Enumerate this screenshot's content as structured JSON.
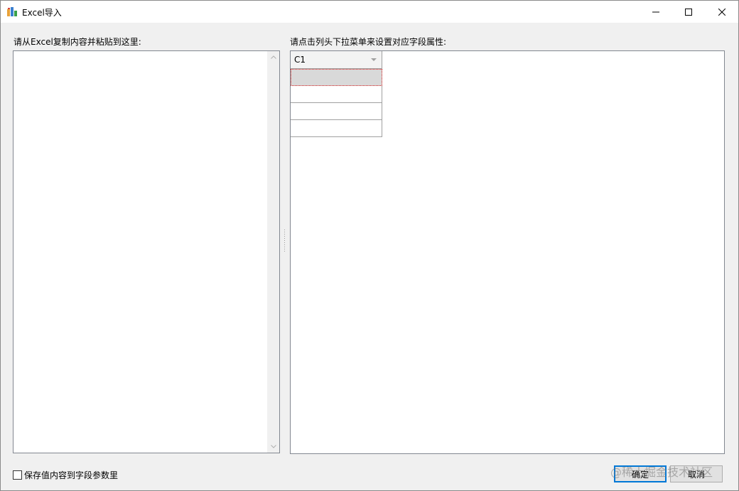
{
  "window": {
    "title": "Excel导入",
    "minimize_icon": "minimize-icon",
    "maximize_icon": "maximize-icon",
    "close_icon": "close-icon"
  },
  "left_panel": {
    "label": "请从Excel复制内容并粘贴到这里:",
    "textarea_value": ""
  },
  "right_panel": {
    "label": "请点击列头下拉菜单来设置对应字段属性:",
    "columns": [
      {
        "header": "C1"
      }
    ],
    "rows": [
      "",
      "",
      "",
      ""
    ],
    "selected_row": 0
  },
  "footer": {
    "checkbox_label": "保存值内容到字段参数里",
    "checkbox_checked": false,
    "ok_label": "确定",
    "cancel_label": "取消",
    "watermark": "@稀土掘金技术社区"
  },
  "colors": {
    "accent": "#0078d7",
    "selection_border": "#d62020"
  }
}
